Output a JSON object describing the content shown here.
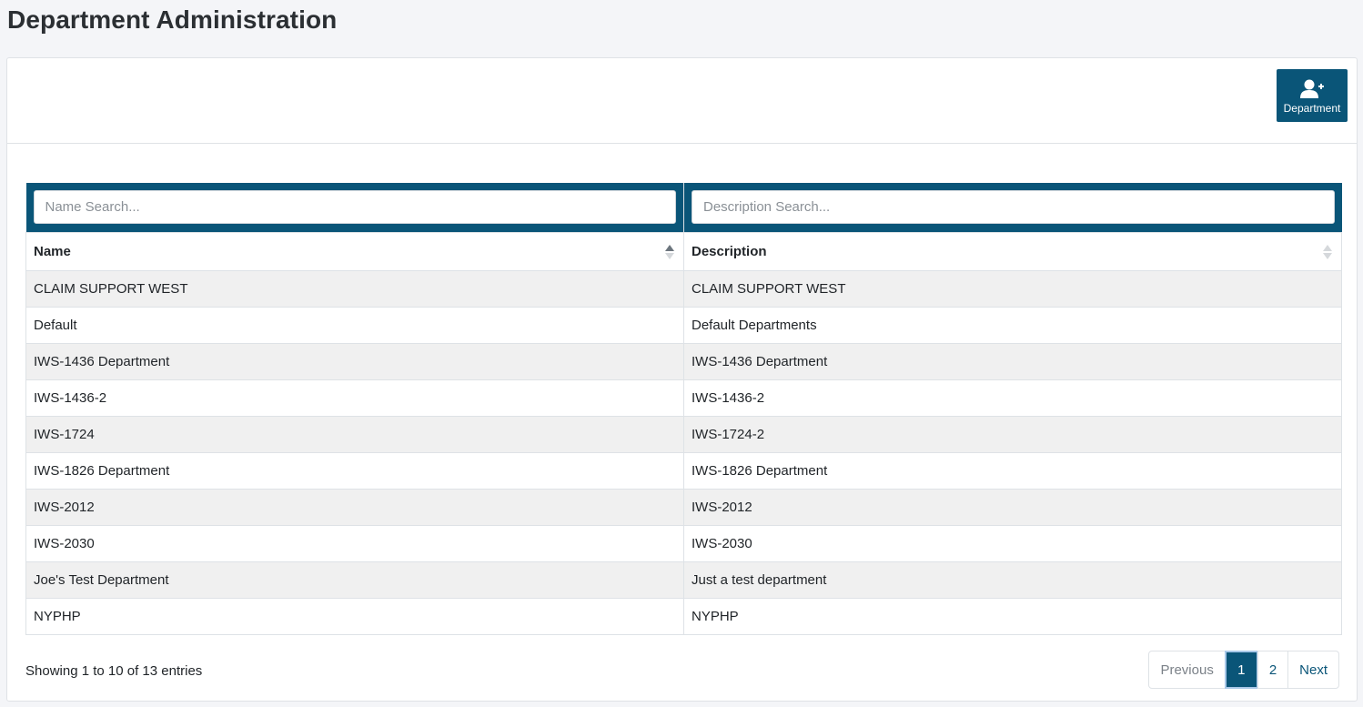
{
  "page": {
    "title": "Department Administration"
  },
  "toolbar": {
    "add_department_label": "Department",
    "add_department_icon": "user-plus-icon"
  },
  "table": {
    "search": {
      "name_placeholder": "Name Search...",
      "description_placeholder": "Description Search..."
    },
    "columns": [
      {
        "label": "Name",
        "sort": "ascending"
      },
      {
        "label": "Description",
        "sort": "none"
      }
    ],
    "rows": [
      {
        "name": "CLAIM SUPPORT WEST",
        "description": "CLAIM SUPPORT WEST"
      },
      {
        "name": "Default",
        "description": "Default Departments"
      },
      {
        "name": "IWS-1436 Department",
        "description": "IWS-1436 Department"
      },
      {
        "name": "IWS-1436-2",
        "description": "IWS-1436-2"
      },
      {
        "name": "IWS-1724",
        "description": "IWS-1724-2"
      },
      {
        "name": "IWS-1826 Department",
        "description": "IWS-1826 Department"
      },
      {
        "name": "IWS-2012",
        "description": "IWS-2012"
      },
      {
        "name": "IWS-2030",
        "description": "IWS-2030"
      },
      {
        "name": "Joe's Test Department",
        "description": "Just a test department"
      },
      {
        "name": "NYPHP",
        "description": "NYPHP"
      }
    ]
  },
  "footer": {
    "info": "Showing 1 to 10 of 13 entries",
    "pagination": {
      "previous": "Previous",
      "pages": [
        "1",
        "2"
      ],
      "current": "1",
      "next": "Next"
    }
  },
  "colors": {
    "primary": "#0a5578",
    "row_stripe": "#f0f0f0",
    "background": "#f4f5f8"
  }
}
